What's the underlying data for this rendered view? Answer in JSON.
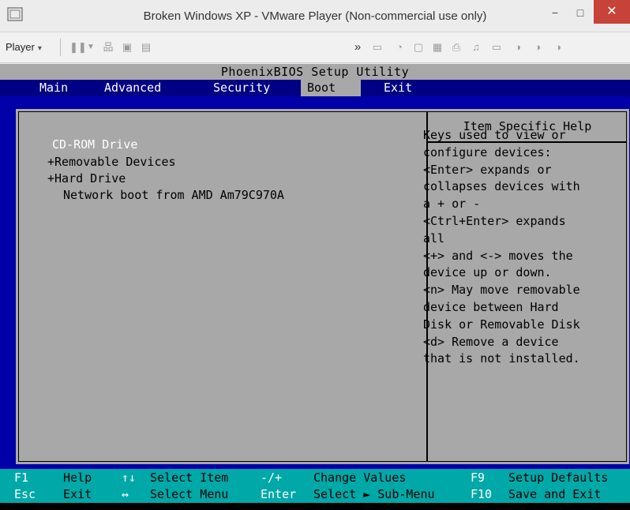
{
  "window": {
    "title": "Broken Windows XP - VMware Player (Non-commercial use only)",
    "app_icon": "vmware-player-icon",
    "buttons": {
      "minimize": "−",
      "maximize": "□",
      "close": "✕"
    }
  },
  "toolbar": {
    "player_label": "Player",
    "caret": "▾",
    "more": "»",
    "icons": [
      "pause-icon",
      "dropdown-caret-icon",
      "network-icon",
      "fullscreen-icon",
      "unity-icon",
      "hard-disk-icon",
      "cd-drive-icon",
      "floppy-icon",
      "network-adapter-icon",
      "printer-icon",
      "sound-icon",
      "usb-icon",
      "serial-port-1-icon",
      "serial-port-2-icon",
      "serial-port-3-icon"
    ]
  },
  "bios": {
    "title": "PhoenixBIOS Setup Utility",
    "menu": [
      {
        "label": "Main",
        "active": false
      },
      {
        "label": "Advanced",
        "active": false
      },
      {
        "label": "Security",
        "active": false
      },
      {
        "label": "Boot",
        "active": true
      },
      {
        "label": "Exit",
        "active": false
      }
    ],
    "boot_items": [
      {
        "text": "CD-ROM Drive",
        "selected": true
      },
      {
        "text": "+Removable Devices",
        "selected": false
      },
      {
        "text": "+Hard Drive",
        "selected": false
      },
      {
        "text": "Network boot from AMD Am79C970A",
        "selected": false
      }
    ],
    "help_title": "Item Specific Help",
    "help_text": "Keys used to view or\nconfigure devices:\n<Enter> expands or\ncollapses devices with\na + or -\n<Ctrl+Enter> expands\nall\n<+> and <-> moves the\ndevice up or down.\n<n> May move removable\ndevice between Hard\nDisk or Removable Disk\n<d> Remove a device\nthat is not installed.",
    "footer": {
      "row1": [
        {
          "key": "F1",
          "label": "Help"
        },
        {
          "key": "↑↓",
          "label": "Select Item"
        },
        {
          "key": "-/+",
          "label": "Change Values"
        },
        {
          "key": "F9",
          "label": "Setup Defaults"
        }
      ],
      "row2": [
        {
          "key": "Esc",
          "label": "Exit"
        },
        {
          "key": "↔",
          "label": "Select Menu"
        },
        {
          "key": "Enter",
          "label": "Select ► Sub-Menu"
        },
        {
          "key": "F10",
          "label": "Save and Exit"
        }
      ]
    },
    "colors": {
      "background": "#0000a8",
      "selected_text": "#ffffff",
      "panel": "#a8a8a8",
      "footer": "#00a8a8"
    }
  }
}
